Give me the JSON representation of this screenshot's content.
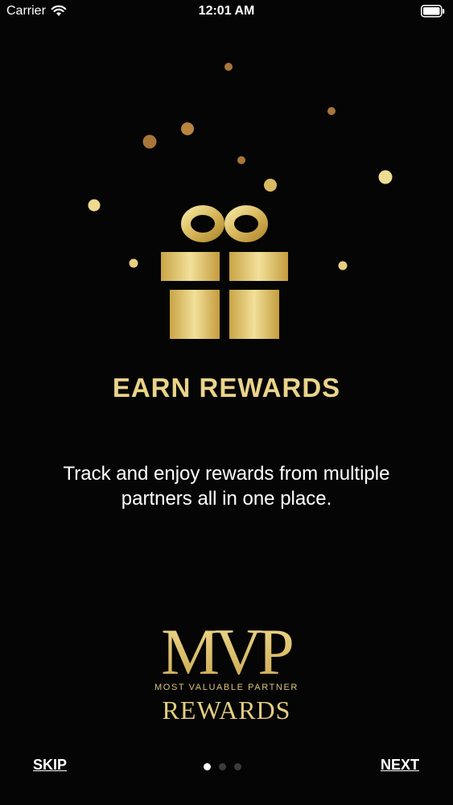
{
  "status_bar": {
    "carrier": "Carrier",
    "time": "12:01 AM",
    "wifi_icon": "wifi-icon",
    "battery_icon": "battery-icon"
  },
  "illustration": {
    "icon": "gift-icon"
  },
  "onboarding": {
    "title": "EARN REWARDS",
    "description": "Track and enjoy rewards from multiple partners all in one place."
  },
  "brand": {
    "monogram": "MVP",
    "tagline": "MOST VALUABLE PARTNER",
    "name": "REWARDS"
  },
  "navigation": {
    "skip_label": "SKIP",
    "next_label": "NEXT",
    "page_count": 3,
    "current_page": 1
  },
  "colors": {
    "gold": "#ead38a",
    "background": "#050505",
    "dot_inactive": "#3b3b3b",
    "dot_active": "#ffffff"
  }
}
